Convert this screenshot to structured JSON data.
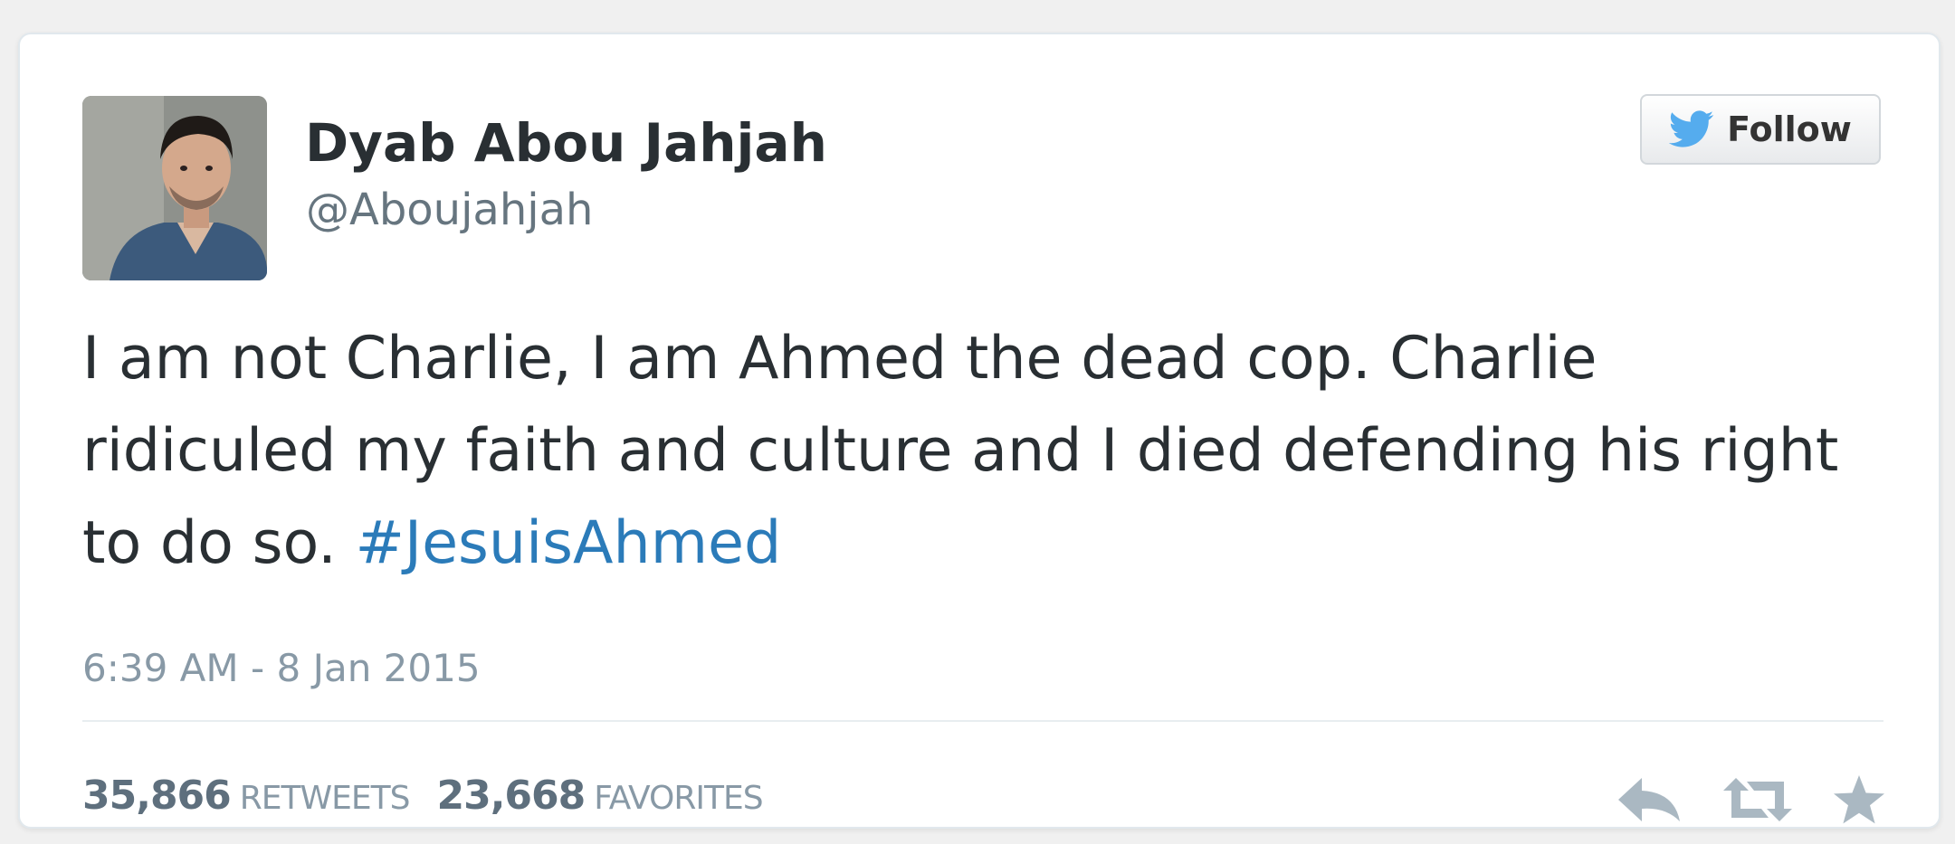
{
  "user": {
    "name": "Dyab Abou Jahjah",
    "handle": "@Aboujahjah"
  },
  "follow_button": {
    "label": "Follow",
    "icon": "twitter-bird-icon"
  },
  "tweet": {
    "text": "I am not Charlie, I am Ahmed the dead cop. Charlie ridiculed my faith and culture and I died defending his right to do so.",
    "hashtag": "#JesuisAhmed",
    "timestamp": "6:39 AM - 8 Jan 2015"
  },
  "stats": {
    "retweets_count": "35,866",
    "retweets_label": "RETWEETS",
    "favorites_count": "23,668",
    "favorites_label": "FAVORITES"
  },
  "actions": [
    {
      "name": "reply",
      "icon": "reply-icon"
    },
    {
      "name": "retweet",
      "icon": "retweet-icon"
    },
    {
      "name": "favorite",
      "icon": "star-icon"
    }
  ],
  "colors": {
    "text": "#292f33",
    "muted": "#8899a6",
    "hashtag": "#2b7bb9",
    "twitter_blue": "#55acee",
    "action_gray": "#aab8c2"
  }
}
